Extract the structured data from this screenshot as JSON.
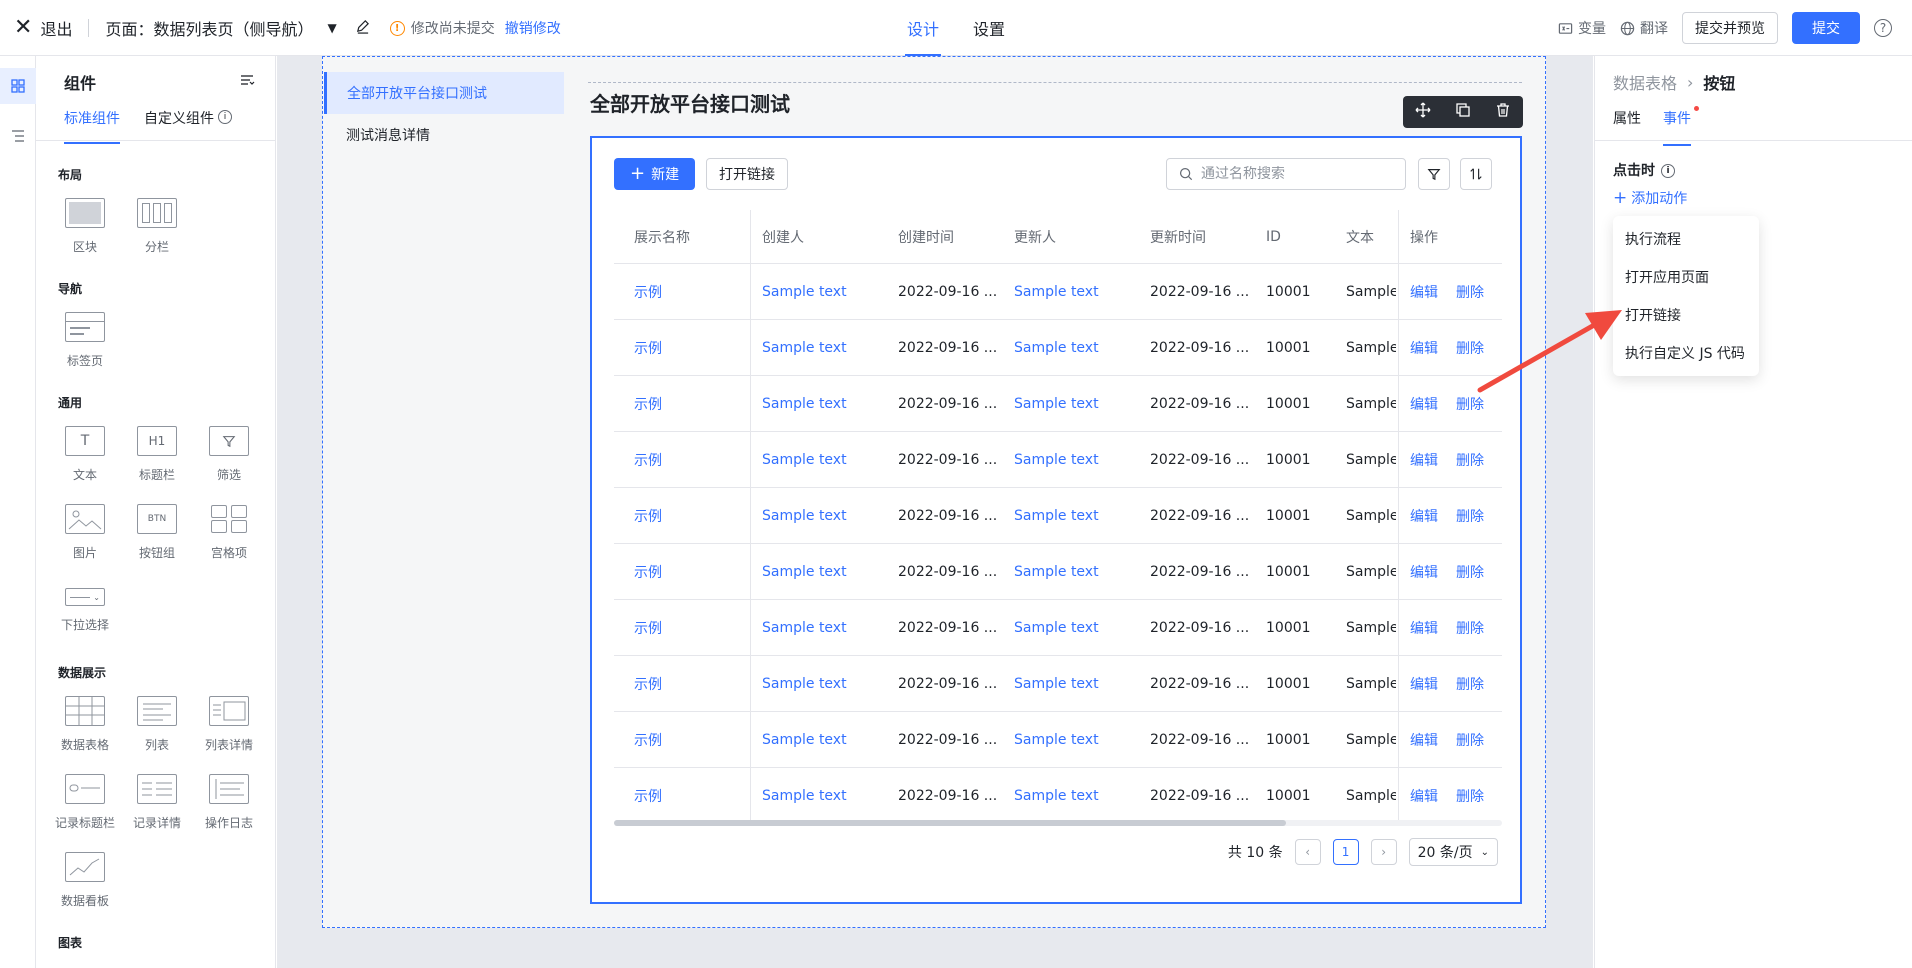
{
  "topbar": {
    "exit_label": "退出",
    "page_title": "页面：数据列表页（侧导航）",
    "warning_text": "修改尚未提交",
    "undo_label": "撤销修改",
    "tabs": [
      {
        "label": "设计",
        "active": true
      },
      {
        "label": "设置",
        "active": false
      }
    ],
    "variables_label": "变量",
    "translate_label": "翻译",
    "submit_preview_label": "提交并预览",
    "submit_label": "提交"
  },
  "components_panel": {
    "title": "组件",
    "tabs": [
      {
        "label": "标准组件",
        "active": true
      },
      {
        "label": "自定义组件",
        "active": false
      }
    ],
    "sections": [
      {
        "title": "布局",
        "items": [
          "区块",
          "分栏"
        ]
      },
      {
        "title": "导航",
        "items": [
          "标签页"
        ]
      },
      {
        "title": "通用",
        "items": [
          "文本",
          "标题栏",
          "筛选",
          "图片",
          "按钮组",
          "宫格项",
          "下拉选择"
        ]
      },
      {
        "title": "数据展示",
        "items": [
          "数据表格",
          "列表",
          "列表详情",
          "记录标题栏",
          "记录详情",
          "操作日志",
          "数据看板"
        ]
      },
      {
        "title": "图表",
        "items": []
      }
    ],
    "btn_thumb_text": "BTN"
  },
  "canvas": {
    "nav_items": [
      {
        "label": "全部开放平台接口测试",
        "active": true
      },
      {
        "label": "测试消息详情",
        "active": false
      }
    ],
    "card_title": "全部开放平台接口测试",
    "new_button": "新建",
    "open_link_button": "打开链接",
    "search_placeholder": "通过名称搜索",
    "table": {
      "columns": [
        "展示名称",
        "创建人",
        "创建时间",
        "更新人",
        "更新时间",
        "ID",
        "文本",
        "操作"
      ],
      "rows": [
        [
          "示例",
          "Sample text",
          "2022-09-16 ...",
          "Sample text",
          "2022-09-16 ...",
          "10001",
          "Sample"
        ],
        [
          "示例",
          "Sample text",
          "2022-09-16 ...",
          "Sample text",
          "2022-09-16 ...",
          "10001",
          "Sample"
        ],
        [
          "示例",
          "Sample text",
          "2022-09-16 ...",
          "Sample text",
          "2022-09-16 ...",
          "10001",
          "Sample"
        ],
        [
          "示例",
          "Sample text",
          "2022-09-16 ...",
          "Sample text",
          "2022-09-16 ...",
          "10001",
          "Sample"
        ],
        [
          "示例",
          "Sample text",
          "2022-09-16 ...",
          "Sample text",
          "2022-09-16 ...",
          "10001",
          "Sample"
        ],
        [
          "示例",
          "Sample text",
          "2022-09-16 ...",
          "Sample text",
          "2022-09-16 ...",
          "10001",
          "Sample"
        ],
        [
          "示例",
          "Sample text",
          "2022-09-16 ...",
          "Sample text",
          "2022-09-16 ...",
          "10001",
          "Sample"
        ],
        [
          "示例",
          "Sample text",
          "2022-09-16 ...",
          "Sample text",
          "2022-09-16 ...",
          "10001",
          "Sample"
        ],
        [
          "示例",
          "Sample text",
          "2022-09-16 ...",
          "Sample text",
          "2022-09-16 ...",
          "10001",
          "Sample"
        ],
        [
          "示例",
          "Sample text",
          "2022-09-16 ...",
          "Sample text",
          "2022-09-16 ...",
          "10001",
          "Sample"
        ]
      ],
      "edit_label": "编辑",
      "delete_label": "删除"
    },
    "pagination": {
      "total": "共 10 条",
      "current_page": "1",
      "page_size": "20 条/页"
    }
  },
  "props_panel": {
    "breadcrumb_parent": "数据表格",
    "breadcrumb_current": "按钮",
    "tabs": [
      {
        "label": "属性",
        "active": false
      },
      {
        "label": "事件",
        "active": true
      }
    ],
    "onclick_label": "点击时",
    "add_action_label": "添加动作",
    "action_menu": [
      "执行流程",
      "打开应用页面",
      "打开链接",
      "执行自定义 JS 代码"
    ]
  },
  "colors": {
    "accent": "#3370ff",
    "annotation_arrow": "#f04a3e",
    "warning": "#ff8800"
  }
}
